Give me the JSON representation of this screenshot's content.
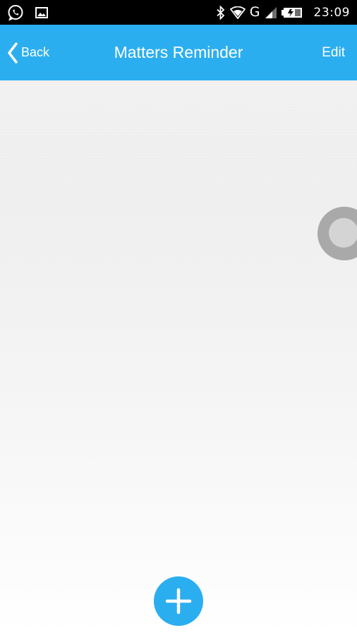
{
  "status_bar": {
    "time": "23:09",
    "network_type": "G",
    "icons": {
      "left": [
        "whatsapp-icon",
        "gallery-icon"
      ],
      "right": [
        "bluetooth-icon",
        "wifi-icon",
        "network-letter",
        "signal-icon",
        "battery-icon"
      ]
    }
  },
  "nav": {
    "back_label": "Back",
    "title": "Matters Reminder",
    "edit_label": "Edit"
  },
  "colors": {
    "primary": "#2baef0",
    "status_bar": "#000000"
  },
  "fab": {
    "icon": "plus-icon"
  },
  "floating_widget": {
    "icon": "assistive-touch-icon"
  }
}
